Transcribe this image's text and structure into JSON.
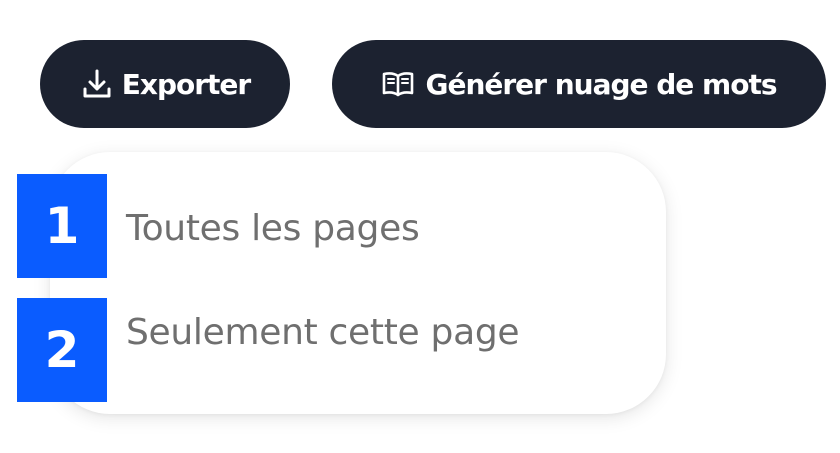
{
  "toolbar": {
    "export_label": "Exporter",
    "wordcloud_label": "Générer nuage de mots",
    "export_icon": "download-icon",
    "wordcloud_icon": "open-book-icon"
  },
  "export_menu": {
    "items": [
      {
        "label": "Toutes les pages",
        "marker": "1"
      },
      {
        "label": "Seulement cette page",
        "marker": "2"
      }
    ]
  },
  "colors": {
    "button_bg": "#1c2230",
    "button_text": "#ffffff",
    "menu_text": "#6f6f6f",
    "marker_bg": "#0a5cff"
  }
}
